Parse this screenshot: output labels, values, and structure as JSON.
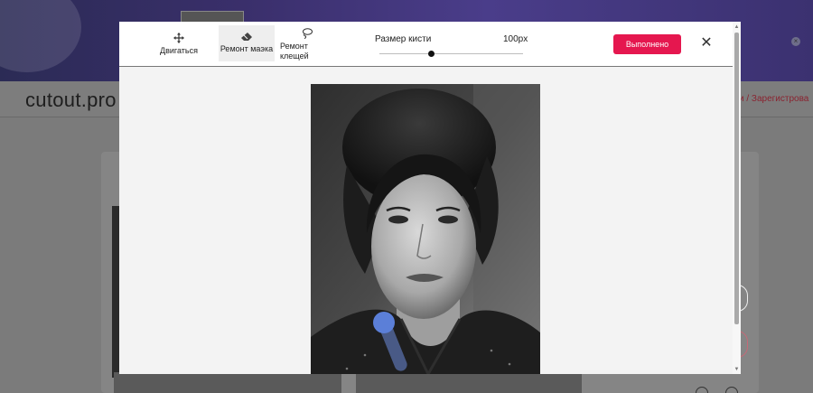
{
  "background": {
    "logo_text": "cutout.pro",
    "register_link": "и / Зарегистрова"
  },
  "modal": {
    "tools": [
      {
        "label": "Двигаться",
        "icon": "move-icon"
      },
      {
        "label": "Ремонт маэка",
        "icon": "eraser-icon"
      },
      {
        "label": "Ремонт клещей",
        "icon": "lasso-icon"
      }
    ],
    "brush_size_label": "Размер кисти",
    "brush_size_value": "100px",
    "brush_size_level": 0.36,
    "done_label": "Выполнено",
    "close_icon": "close-icon",
    "colors": {
      "accent": "#e5174f",
      "brush": "#5b7fd8"
    }
  }
}
